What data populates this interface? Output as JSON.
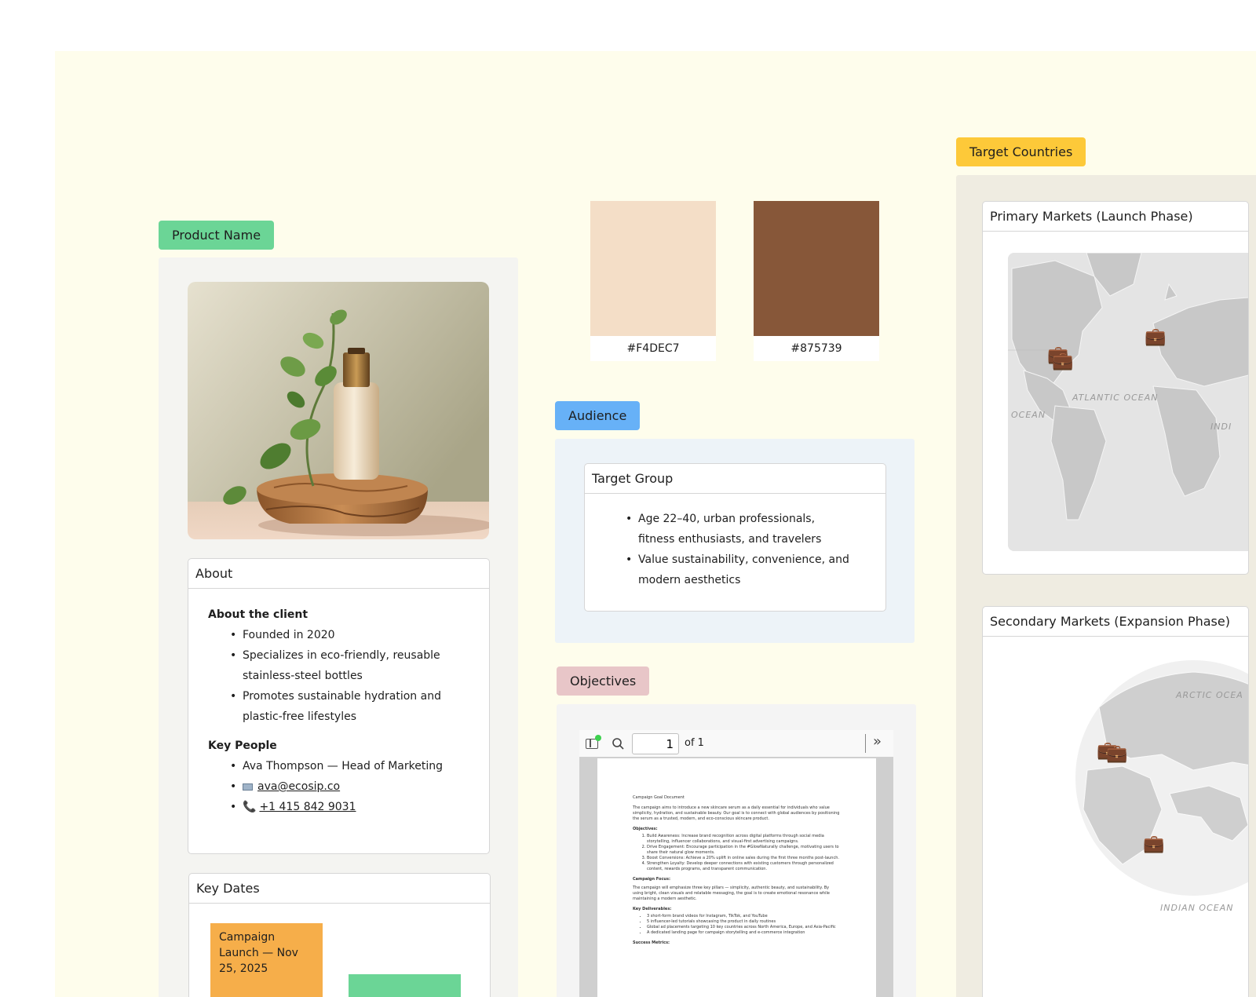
{
  "product": {
    "tag": "Product Name",
    "about": {
      "header": "About",
      "client_heading": "About the client",
      "client_items": [
        "Founded in 2020",
        "Specializes in eco-friendly, reusable stainless-steel bottles",
        "Promotes sustainable hydration and plastic-free lifestyles"
      ],
      "people_heading": "Key People",
      "person": "Ava Thompson — Head of Marketing",
      "email": "ava@ecosip.co",
      "phone": "+1 415 842 9031"
    },
    "key_dates": {
      "header": "Key Dates",
      "note": "Campaign Launch — Nov 25, 2025"
    }
  },
  "palette": [
    {
      "hex": "#F4DEC7",
      "color": "#F4DEC7"
    },
    {
      "hex": "#875739",
      "color": "#875739"
    }
  ],
  "audience": {
    "tag": "Audience",
    "header": "Target Group",
    "items": [
      "Age 22–40, urban professionals, fitness enthusiasts, and travelers",
      "Value sustainability, convenience, and modern aesthetics"
    ]
  },
  "objectives": {
    "tag": "Objectives",
    "viewer": {
      "page": "1",
      "of": "of 1",
      "title": "Campaign Goal Document",
      "intro": "The campaign aims to introduce a new skincare serum as a daily essential for individuals who value simplicity, hydration, and sustainable beauty. Our goal is to connect with global audiences by positioning the serum as a trusted, modern, and eco-conscious skincare product.",
      "objectives_heading": "Objectives:",
      "objectives": [
        "Build Awareness: Increase brand recognition across digital platforms through social media storytelling, influencer collaborations, and visual-first advertising campaigns.",
        "Drive Engagement: Encourage participation in the #GlowNaturally challenge, motivating users to share their natural glow moments.",
        "Boost Conversions: Achieve a 20% uplift in online sales during the first three months post-launch.",
        "Strengthen Loyalty: Develop deeper connections with existing customers through personalized content, rewards programs, and transparent communication."
      ],
      "focus_heading": "Campaign Focus:",
      "focus": "The campaign will emphasize three key pillars — simplicity, authentic beauty, and sustainability. By using bright, clean visuals and relatable messaging, the goal is to create emotional resonance while maintaining a modern aesthetic.",
      "deliverables_heading": "Key Deliverables:",
      "deliverables": [
        "3 short-form brand videos for Instagram, TikTok, and YouTube",
        "5 influencer-led tutorials showcasing the product in daily routines",
        "Global ad placements targeting 10 key countries across North America, Europe, and Asia-Pacific",
        "A dedicated landing page for campaign storytelling and e-commerce integration"
      ],
      "metrics_heading": "Success Metrics:"
    }
  },
  "countries": {
    "tag": "Target Countries",
    "primary_header": "Primary Markets (Launch Phase)",
    "secondary_header": "Secondary Markets (Expansion Phase)",
    "ocean_labels": {
      "atlantic": "ATLANTIC OCEAN",
      "ocean": "OCEAN",
      "indian_cut": "INDI",
      "arctic": "ARCTIC OCEA",
      "indian": "INDIAN OCEAN"
    },
    "pin_icon": "briefcase-icon"
  }
}
